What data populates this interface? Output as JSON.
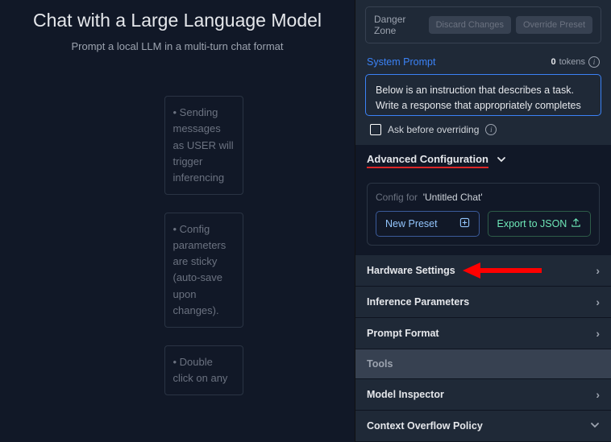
{
  "left": {
    "title": "Chat with a Large Language Model",
    "subtitle": "Prompt a local LLM in a multi-turn chat format",
    "hints": [
      "• Sending messages as USER will trigger inferencing",
      "• Config parameters are sticky (auto-save upon changes).",
      "• Double click on any"
    ]
  },
  "right": {
    "danger": {
      "label": "Danger Zone",
      "discard": "Discard Changes",
      "override": "Override Preset"
    },
    "sysPrompt": {
      "label": "System Prompt",
      "tokensCount": "0",
      "tokensLabel": "tokens",
      "value": "Below is an instruction that describes a task. Write a response that appropriately completes the request."
    },
    "askLabel": "Ask before overriding",
    "advanced": "Advanced Configuration",
    "configFor": "Config for",
    "configName": "'Untitled Chat'",
    "newPreset": "New Preset",
    "exportJson": "Export to JSON",
    "rows": {
      "hardware": "Hardware Settings",
      "inference": "Inference Parameters",
      "prompt": "Prompt Format",
      "tools": "Tools",
      "inspector": "Model Inspector",
      "overflow": "Context Overflow Policy"
    }
  }
}
